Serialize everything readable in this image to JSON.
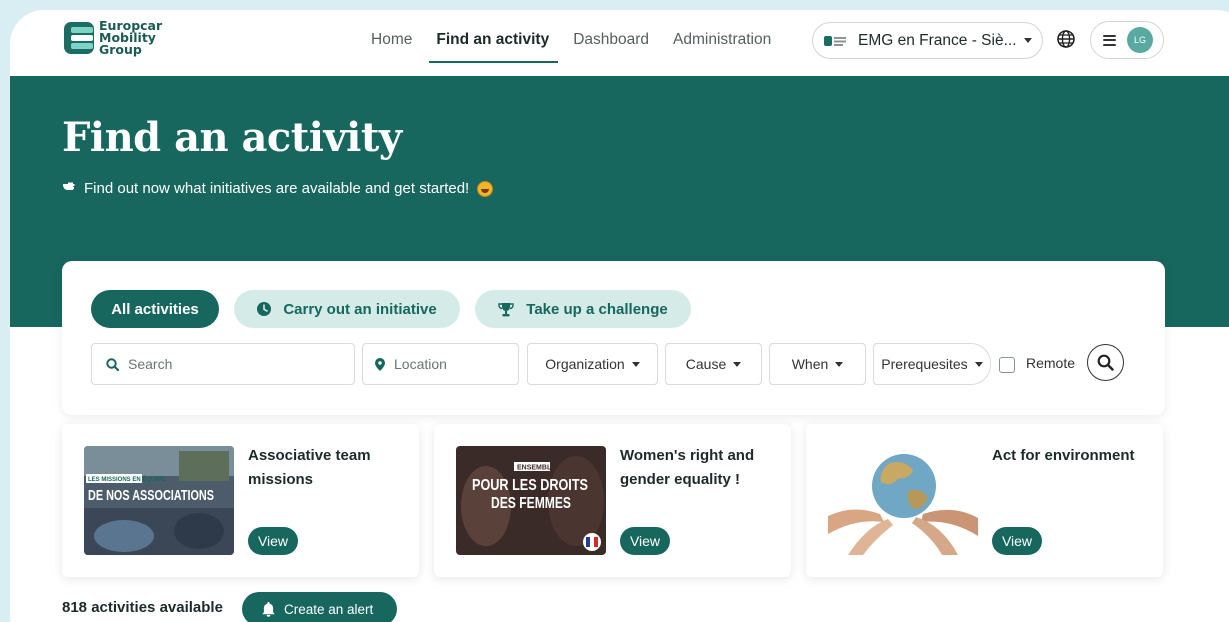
{
  "brand": {
    "logo_lines": [
      "Europcar",
      "Mobility",
      "Group"
    ]
  },
  "nav": {
    "items": [
      {
        "label": "Home",
        "active": false
      },
      {
        "label": "Find an activity",
        "active": true
      },
      {
        "label": "Dashboard",
        "active": false
      },
      {
        "label": "Administration",
        "active": false
      }
    ],
    "org_selector": "EMG en France - Siè...",
    "user_initials": "LG"
  },
  "hero": {
    "title": "Find an activity",
    "subtitle": "Find out now what initiatives are available and get started!"
  },
  "filters": {
    "tabs": [
      {
        "label": "All activities",
        "icon": "",
        "active": true
      },
      {
        "label": "Carry out an initiative",
        "icon": "clock-icon",
        "active": false
      },
      {
        "label": "Take up a challenge",
        "icon": "trophy-icon",
        "active": false
      }
    ],
    "search_placeholder": "Search",
    "location_placeholder": "Location",
    "dropdowns": [
      "Organization",
      "Cause",
      "When",
      "Prerequesites"
    ],
    "remote_label": "Remote"
  },
  "activities": [
    {
      "title": "Associative team missions",
      "image_caption_small": "LES MISSIONS EN ÉQUIPE",
      "image_caption": "DE NOS ASSOCIATIONS",
      "button": "View"
    },
    {
      "title": "Women's right and gender equality !",
      "image_caption_small": "ENSEMBLE",
      "image_caption": "POUR LES DROITS DES FEMMES",
      "button": "View"
    },
    {
      "title": "Act for environment",
      "image_caption_small": "",
      "image_caption": "",
      "button": "View"
    }
  ],
  "footer": {
    "count_text": "818 activities available",
    "alert_button": "Create an alert"
  },
  "colors": {
    "primary": "#17675e",
    "primary_light": "#d5ebe8",
    "page_bg": "#d9eef2"
  }
}
